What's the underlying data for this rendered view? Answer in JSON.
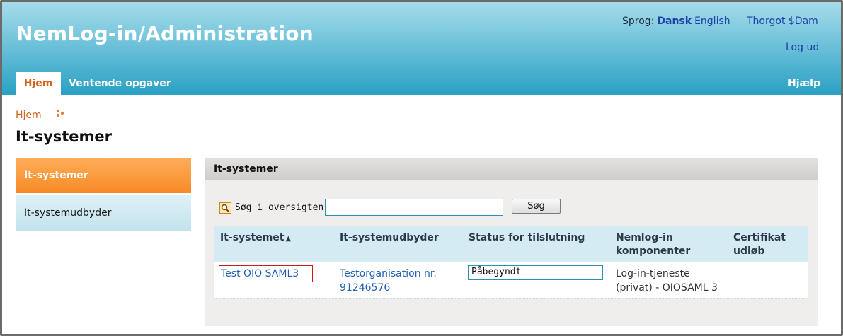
{
  "app": {
    "title": "NemLog-in/Administration"
  },
  "header": {
    "lang_label": "Sprog:",
    "lang_dansk": "Dansk",
    "lang_english": "English",
    "user": "Thorgot $Dam",
    "logout": "Log ud",
    "help": "Hjælp"
  },
  "nav": {
    "tabs": [
      {
        "label": "Hjem"
      },
      {
        "label": "Ventende opgaver"
      }
    ]
  },
  "breadcrumb": {
    "home": "Hjem"
  },
  "page": {
    "title": "It-systemer"
  },
  "sidebar": {
    "items": [
      {
        "label": "It-systemer"
      },
      {
        "label": "It-systemudbyder"
      }
    ]
  },
  "panel": {
    "title": "It-systemer",
    "search_label": "Søg i oversigten:",
    "search_value": "",
    "search_button": "Søg"
  },
  "table": {
    "headers": {
      "system": "It-systemet",
      "provider": "It-systemudbyder",
      "status": "Status for tilslutning",
      "components_1": "Nemlog-in",
      "components_2": "komponenter",
      "cert_1": "Certifikat",
      "cert_2": "udløb"
    },
    "rows": [
      {
        "system": "Test OIO SAML3",
        "provider_1": "Testorganisation nr.",
        "provider_2": "91246576",
        "status": "Påbegyndt",
        "components_1": "Log-in-tjeneste",
        "components_2": "(privat) - OIOSAML 3",
        "cert": ""
      }
    ]
  },
  "colors": {
    "accent_orange": "#f78a25",
    "header_blue": "#29a0c4",
    "link_blue": "#1f5fb4",
    "highlight_red": "#d01818"
  }
}
